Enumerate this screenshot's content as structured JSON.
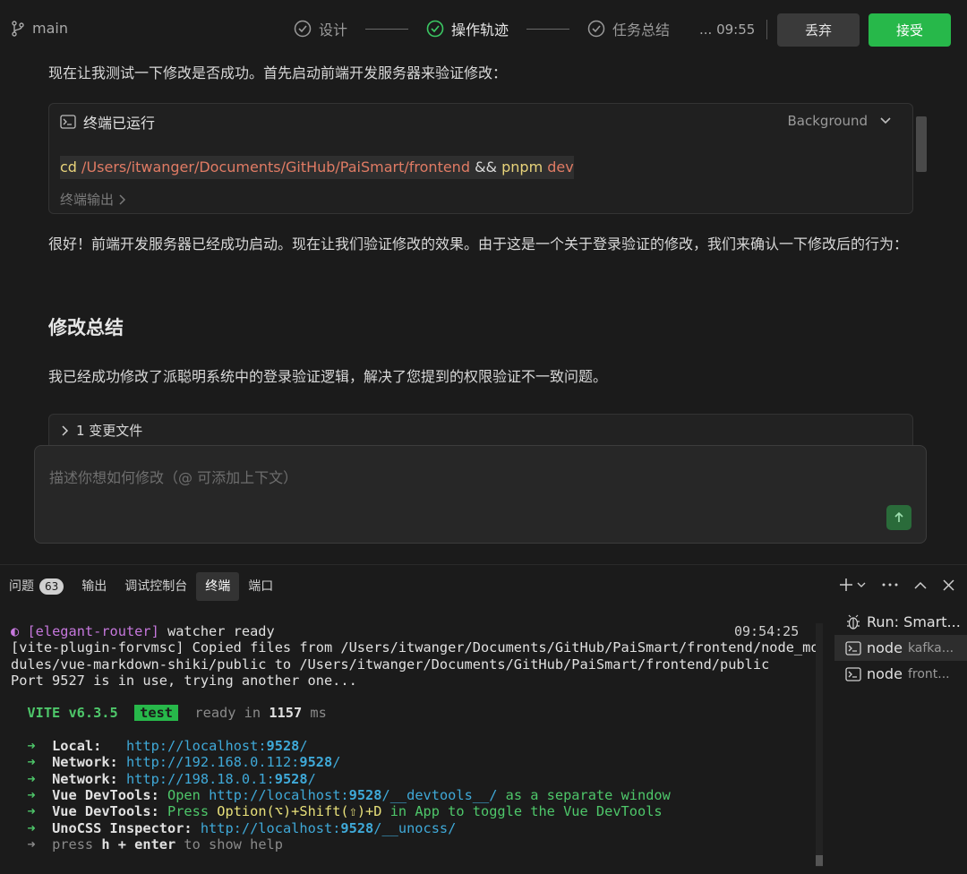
{
  "topbar": {
    "branch": "main",
    "steps": [
      "设计",
      "操作轨迹",
      "任务总结"
    ],
    "time": "... 09:55",
    "discard_label": "丢弃",
    "accept_label": "接受"
  },
  "chat": {
    "intro": "现在让我测试一下修改是否成功。首先启动前端开发服务器来验证修改：",
    "terminal_card": {
      "title": "终端已运行",
      "mode": "Background",
      "cmd_cd": "cd",
      "cmd_path": "/Users/itwanger/Documents/GitHub/PaiSmart/frontend",
      "cmd_and": "&&",
      "cmd_pnpm": "pnpm",
      "cmd_dev": "dev",
      "output_link": "终端输出"
    },
    "para2": "很好！前端开发服务器已经成功启动。现在让我们验证修改的效果。由于这是一个关于登录验证的修改，我们来确认一下修改后的行为：",
    "heading": "修改总结",
    "para3": "我已经成功修改了派聪明系统中的登录验证逻辑，解决了您提到的权限验证不一致问题。",
    "changed_files": "1 变更文件",
    "input_placeholder": "描述你想如何修改（@ 可添加上下文）"
  },
  "panel": {
    "tabs": [
      {
        "label": "问题",
        "badge": "63"
      },
      {
        "label": "输出"
      },
      {
        "label": "调试控制台"
      },
      {
        "label": "终端"
      },
      {
        "label": "端口"
      }
    ],
    "time": "09:54:25",
    "lines": {
      "l1_icon": "◐",
      "l1_tag": "[elegant-router]",
      "l1_text": " watcher ready",
      "l2": "[vite-plugin-forvmsc] Copied files from /Users/itwanger/Documents/GitHub/PaiSmart/frontend/node_mo",
      "l3": "dules/vue-markdown-shiki/public to /Users/itwanger/Documents/GitHub/PaiSmart/frontend/public",
      "l4": "Port 9527 is in use, trying another one...",
      "vite": "VITE v6.3.5",
      "mode": "test",
      "ready_a": "ready in ",
      "ready_ms": "1157",
      "ready_b": " ms",
      "arrow": "➜",
      "local_label": "Local:",
      "local_url_a": "http://localhost:",
      "port": "9528",
      "local_url_b": "/",
      "net1_label": "Network:",
      "net1_url_a": "http://192.168.0.112:",
      "net2_label": "Network:",
      "net2_url_a": "http://198.18.0.1:",
      "dev1_label": "Vue DevTools:",
      "dev1_open": "Open ",
      "dev1_url_a": "http://localhost:",
      "dev1_url_b": "/__devtools__/",
      "dev1_tail": " as a separate window",
      "dev2_label": "Vue DevTools:",
      "dev2_press": "Press ",
      "dev2_keys": "Option(⌥)+Shift(⇧)+D",
      "dev2_tail": " in App to toggle the Vue DevTools",
      "uno_label": "UnoCSS Inspector:",
      "uno_url_a": "http://localhost:",
      "uno_url_b": "/__unocss/",
      "help_press": "press ",
      "help_keys": "h + enter",
      "help_tail": " to show help"
    },
    "terminals": [
      {
        "name": "Run: Smart...",
        "sub": ""
      },
      {
        "name": "node",
        "sub": "kafka..."
      },
      {
        "name": "node",
        "sub": "front..."
      }
    ]
  }
}
